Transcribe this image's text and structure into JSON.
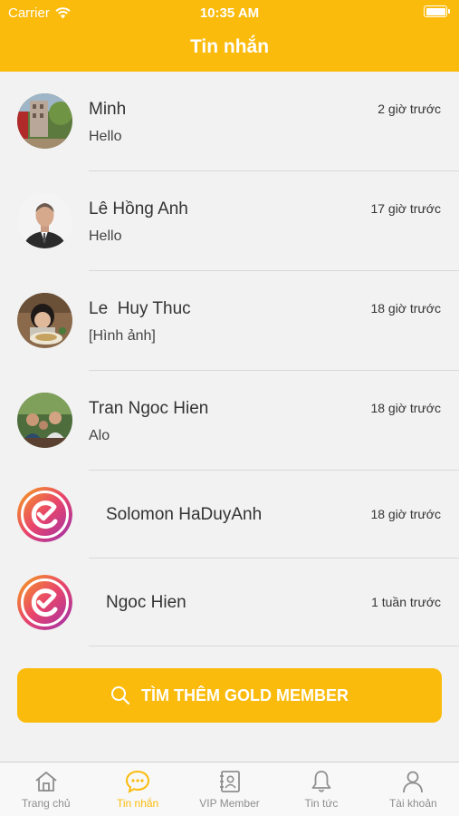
{
  "status_bar": {
    "carrier": "Carrier",
    "time": "10:35 AM"
  },
  "header": {
    "title": "Tin nhắn"
  },
  "conversations": [
    {
      "name": "Minh",
      "message": "Hello",
      "time": "2 giờ trước",
      "avatar": "photo-building"
    },
    {
      "name": "Lê Hồng Anh",
      "message": "Hello",
      "time": "17 giờ trước",
      "avatar": "photo-man-suit"
    },
    {
      "name": "Le  Huy Thuc",
      "message": "[Hình ảnh]",
      "time": "18 giờ trước",
      "avatar": "photo-child"
    },
    {
      "name": "Tran Ngoc Hien",
      "message": "Alo",
      "time": "18 giờ trước",
      "avatar": "photo-group"
    },
    {
      "name": "Solomon HaDuyAnh",
      "message": "",
      "time": "18 giờ trước",
      "avatar": "app-logo"
    },
    {
      "name": "Ngoc Hien",
      "message": "",
      "time": "1 tuần trước",
      "avatar": "app-logo"
    }
  ],
  "cta": {
    "label": "TÌM THÊM GOLD MEMBER",
    "icon": "search-icon"
  },
  "tabs": [
    {
      "label": "Trang chủ",
      "icon": "home-icon",
      "active": false
    },
    {
      "label": "Tin nhắn",
      "icon": "chat-icon",
      "active": true
    },
    {
      "label": "VIP Member",
      "icon": "contact-card-icon",
      "active": false
    },
    {
      "label": "Tin tức",
      "icon": "bell-icon",
      "active": false
    },
    {
      "label": "Tài khoản",
      "icon": "user-icon",
      "active": false
    }
  ],
  "colors": {
    "accent": "#fbbb0c",
    "tab_inactive": "#8e8e8e"
  }
}
